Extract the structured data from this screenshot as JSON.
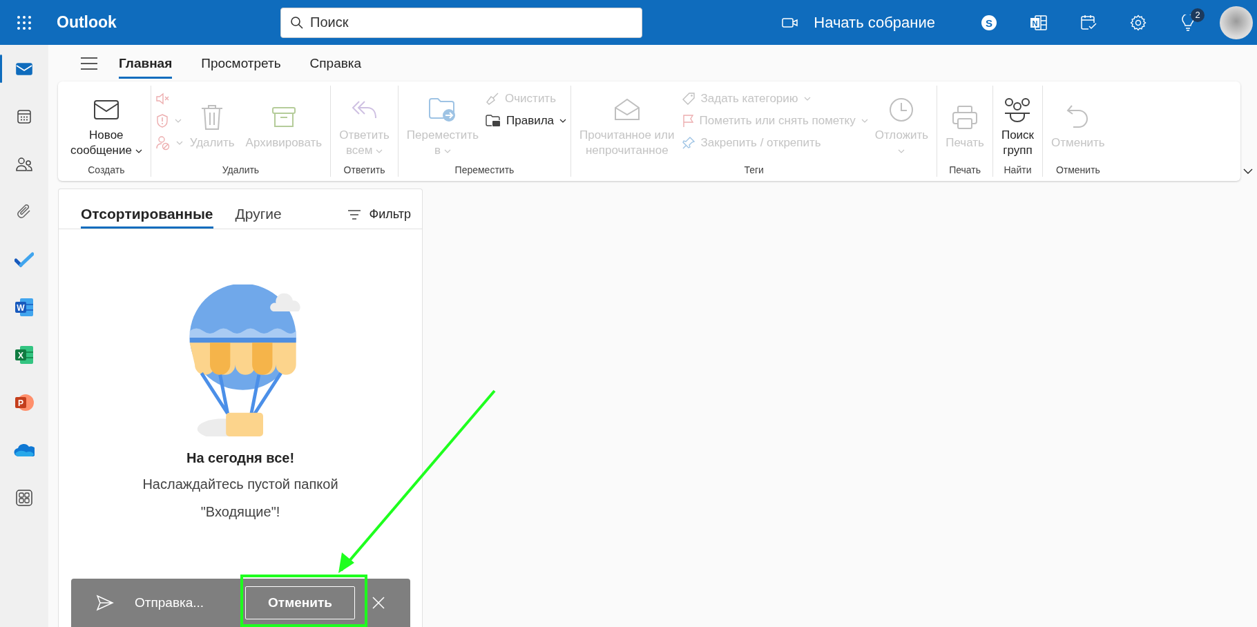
{
  "top_bar": {
    "app_name": "Outlook",
    "search": {
      "placeholder": "Поиск"
    },
    "meeting_button": "Начать собрание",
    "skype": {
      "letter": "S"
    },
    "onenote": {
      "letter": "N"
    },
    "tips": {
      "badge": "2"
    }
  },
  "rail": [
    {
      "selected": true
    },
    {
      "selected": false
    },
    {
      "selected": false
    },
    {
      "selected": false
    },
    {
      "selected": false
    },
    {
      "selected": false,
      "letter": "W"
    },
    {
      "selected": false,
      "letter": "X"
    },
    {
      "selected": false,
      "letter": "P"
    },
    {
      "selected": false
    },
    {
      "selected": false
    }
  ],
  "ribbon_tabs": [
    {
      "label": "Главная",
      "selected": true
    },
    {
      "label": "Просмотреть",
      "selected": false
    },
    {
      "label": "Справка",
      "selected": false
    }
  ],
  "ribbon": {
    "groups": [
      {
        "label": "Создать",
        "items": [
          {
            "kind": "large",
            "lines": [
              "Новое",
              "сообщение"
            ],
            "menu": true,
            "disabled": false
          }
        ]
      },
      {
        "label": "Удалить",
        "items": [
          {
            "kind": "stack",
            "items": [
              {
                "disabled": true
              },
              {
                "menu": true,
                "disabled": true
              },
              {
                "menu": true,
                "disabled": true
              }
            ]
          },
          {
            "kind": "large",
            "lines": [
              "Удалить"
            ],
            "disabled": true
          },
          {
            "kind": "large",
            "lines": [
              "Архивировать"
            ],
            "disabled": true
          }
        ]
      },
      {
        "label": "Ответить",
        "items": [
          {
            "kind": "large",
            "lines": [
              "Ответить",
              "всем"
            ],
            "menu": true,
            "disabled": true
          }
        ]
      },
      {
        "label": "Переместить",
        "items": [
          {
            "kind": "large",
            "lines": [
              "Переместить",
              "в"
            ],
            "menu": true,
            "disabled": true
          },
          {
            "kind": "stack",
            "items": [
              {
                "label": "Очистить",
                "disabled": true
              },
              {
                "label": "Правила",
                "menu": true,
                "disabled": false
              }
            ]
          }
        ]
      },
      {
        "label": "Теги",
        "items": [
          {
            "kind": "large",
            "lines": [
              "Прочитанное или",
              "непрочитанное"
            ],
            "disabled": true
          },
          {
            "kind": "stack",
            "items": [
              {
                "label": "Задать категорию",
                "menu": true,
                "disabled": true
              },
              {
                "label": "Пометить или снять пометку",
                "menu": true,
                "disabled": true
              },
              {
                "label": "Закрепить / открепить",
                "disabled": true
              }
            ]
          },
          {
            "kind": "large",
            "lines": [
              "Отложить"
            ],
            "menu_below": true,
            "disabled": true
          }
        ]
      },
      {
        "label": "Печать",
        "items": [
          {
            "kind": "large",
            "lines": [
              "Печать"
            ],
            "disabled": true
          }
        ]
      },
      {
        "label": "Найти",
        "items": [
          {
            "kind": "large",
            "lines": [
              "Поиск",
              "групп"
            ],
            "disabled": false
          }
        ]
      },
      {
        "label": "Отменить",
        "items": [
          {
            "kind": "large",
            "lines": [
              "Отменить"
            ],
            "disabled": true
          }
        ]
      }
    ]
  },
  "list": {
    "tabs": [
      {
        "label": "Отсортированные",
        "selected": true
      },
      {
        "label": "Другие",
        "selected": false
      }
    ],
    "filter": "Фильтр",
    "empty_title": "На сегодня все!",
    "empty_text": "Наслаждайтесь пустой папкой \"Входящие\"!"
  },
  "toast": {
    "text": "Отправка...",
    "cancel": "Отменить",
    "highlighted": true
  }
}
